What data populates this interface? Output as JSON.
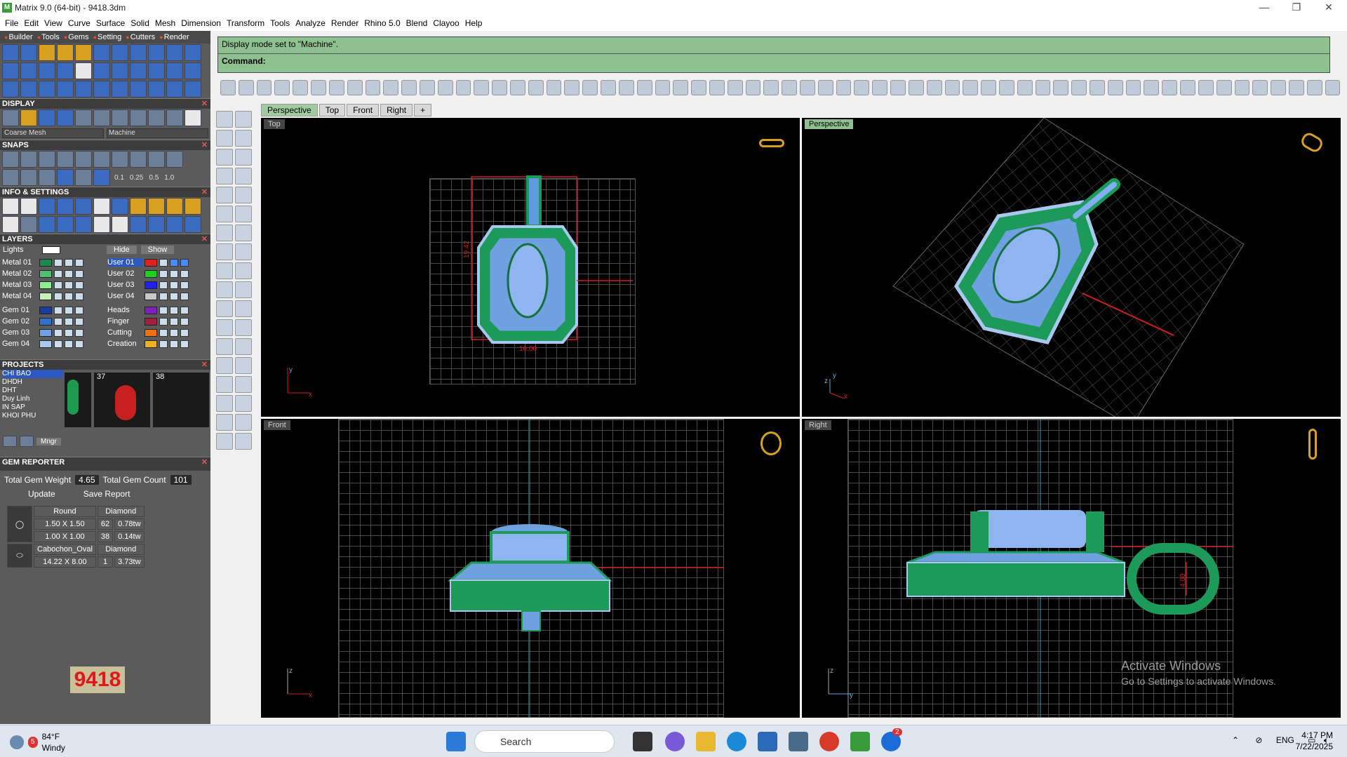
{
  "window": {
    "title": "Matrix 9.0 (64-bit) - 9418.3dm",
    "minimize": "—",
    "maximize": "❐",
    "close": "✕"
  },
  "menu": [
    "File",
    "Edit",
    "View",
    "Curve",
    "Surface",
    "Solid",
    "Mesh",
    "Dimension",
    "Transform",
    "Tools",
    "Analyze",
    "Render",
    "Rhino 5.0",
    "Blend",
    "Clayoo",
    "Help"
  ],
  "left_tabs": [
    "Builder",
    "Tools",
    "Gems",
    "Setting",
    "Cutters",
    "Render"
  ],
  "sections": {
    "display": "DISPLAY",
    "snaps": "SNAPS",
    "info": "INFO & SETTINGS",
    "layers": "LAYERS",
    "projects": "PROJECTS",
    "gem_reporter": "GEM REPORTER"
  },
  "display": {
    "mesh": "Coarse Mesh",
    "mode": "Machine"
  },
  "snaps": {
    "values": [
      "0.1",
      "0.25",
      "0.5",
      "1.0"
    ]
  },
  "layers": {
    "lights": "Lights",
    "hide": "Hide",
    "show": "Show",
    "left": [
      {
        "name": "Metal 01",
        "color": "#1a8a4a"
      },
      {
        "name": "Metal 02",
        "color": "#4cc070"
      },
      {
        "name": "Metal 03",
        "color": "#8cf08c"
      },
      {
        "name": "Metal 04",
        "color": "#c8f0b8"
      },
      {
        "name": "Gem 01",
        "color": "#1a3ea0"
      },
      {
        "name": "Gem 02",
        "color": "#3070d0"
      },
      {
        "name": "Gem 03",
        "color": "#70a0e8"
      },
      {
        "name": "Gem 04",
        "color": "#a8c8f0"
      }
    ],
    "right": [
      {
        "name": "User 01",
        "color": "#e02020"
      },
      {
        "name": "User 02",
        "color": "#20d020"
      },
      {
        "name": "User 03",
        "color": "#2020f0"
      },
      {
        "name": "User 04",
        "color": "#c8c8c8"
      },
      {
        "name": "Heads",
        "color": "#8020c0"
      },
      {
        "name": "Finger",
        "color": "#a02040"
      },
      {
        "name": "Cutting",
        "color": "#f07010"
      },
      {
        "name": "Creation",
        "color": "#f0b020"
      }
    ]
  },
  "projects": {
    "items": [
      "CHI BAO",
      "DHDH",
      "DHT",
      "Duy Linh",
      "IN SAP",
      "KHOI PHU"
    ],
    "thumb_numbers": [
      "37",
      "38"
    ],
    "mngr": "Mngr"
  },
  "gem_reporter": {
    "total_weight_label": "Total Gem Weight",
    "total_weight": "4.65",
    "total_count_label": "Total Gem Count",
    "total_count": "101",
    "update": "Update",
    "save_report": "Save Report",
    "groups": [
      {
        "shape": "Round",
        "material": "Diamond",
        "rows": [
          [
            "1.50 X 1.50",
            "62",
            "0.78tw"
          ],
          [
            "1.00 X 1.00",
            "38",
            "0.14tw"
          ]
        ]
      },
      {
        "shape": "Cabochon_Oval",
        "material": "Diamond",
        "rows": [
          [
            "14.22 X 8.00",
            "1",
            "3.73tw"
          ]
        ]
      }
    ],
    "badge": "9418"
  },
  "command": {
    "line1": "Display mode set to \"Machine\".",
    "prompt": "Command:"
  },
  "viewport_tabs": [
    "Perspective",
    "Top",
    "Front",
    "Right",
    "+"
  ],
  "viewports": {
    "top": "Top",
    "perspective": "Perspective",
    "front": "Front",
    "right": "Right"
  },
  "dims": {
    "top_h": "19.42",
    "top_w": "16.00",
    "right_d": "4.00"
  },
  "activate": {
    "line1": "Activate Windows",
    "line2": "Go to Settings to activate Windows."
  },
  "taskbar": {
    "weather_temp": "84°F",
    "weather_desc": "Windy",
    "weather_badge": "5",
    "search": "Search",
    "lang": "ENG",
    "time": "4:17 PM",
    "date": "7/22/2025",
    "notif_badge": "2"
  }
}
